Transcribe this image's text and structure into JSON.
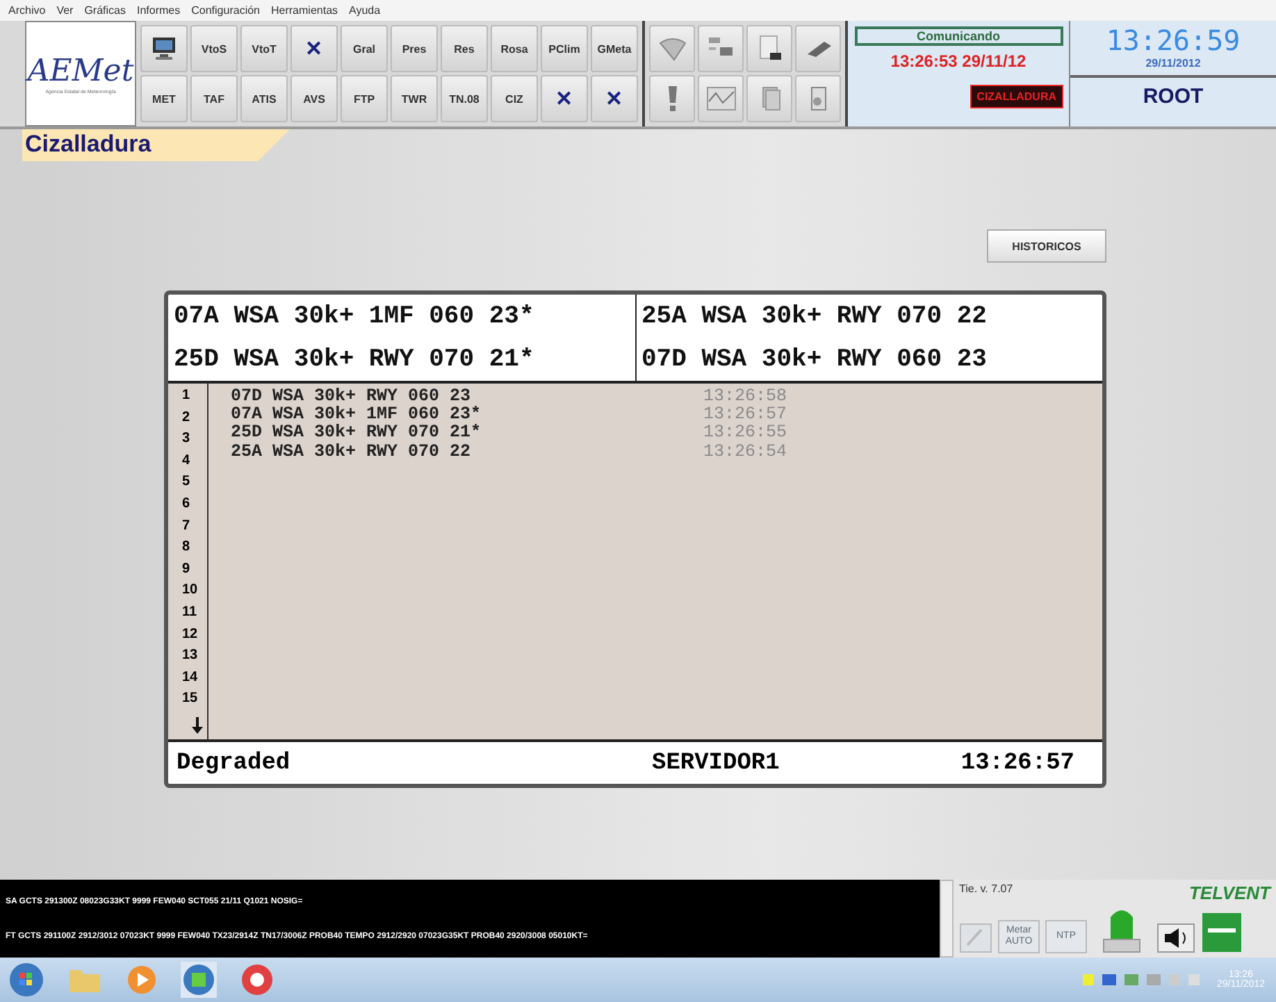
{
  "menu": [
    "Archivo",
    "Ver",
    "Gráficas",
    "Informes",
    "Configuración",
    "Herramientas",
    "Ayuda"
  ],
  "logo": {
    "name": "AEMet",
    "subtitle": "Agencia Estatal de Meteorología"
  },
  "toolbar": {
    "rows": [
      [
        {
          "kind": "monitor"
        },
        {
          "kind": "text",
          "label": "VtoS"
        },
        {
          "kind": "text",
          "label": "VtoT"
        },
        {
          "kind": "x",
          "label": "✕"
        },
        {
          "kind": "text",
          "label": "Gral"
        },
        {
          "kind": "text",
          "label": "Pres"
        },
        {
          "kind": "text",
          "label": "Res"
        },
        {
          "kind": "text",
          "label": "Rosa"
        },
        {
          "kind": "text",
          "label": "PClim"
        },
        {
          "kind": "text",
          "label": "GMeta"
        }
      ],
      [
        {
          "kind": "text",
          "label": "MET"
        },
        {
          "kind": "text",
          "label": "TAF"
        },
        {
          "kind": "text",
          "label": "ATIS"
        },
        {
          "kind": "text",
          "label": "AVS"
        },
        {
          "kind": "text",
          "label": "FTP"
        },
        {
          "kind": "text",
          "label": "TWR"
        },
        {
          "kind": "text",
          "label": "TN.08"
        },
        {
          "kind": "text",
          "label": "CIZ"
        },
        {
          "kind": "x",
          "label": "✕"
        },
        {
          "kind": "x",
          "label": "✕"
        }
      ]
    ]
  },
  "status": {
    "connection": "Comunicando",
    "timestamp": "13:26:53 29/11/12",
    "alert": "CIZALLADURA"
  },
  "clock": {
    "time": "13:26:59",
    "date": "29/11/2012",
    "user": "ROOT"
  },
  "section_title": "Cizalladura",
  "history_button": "HISTORICOS",
  "alerts": [
    [
      "07A WSA 30k+ 1MF 060 23*",
      "25A WSA 30k+ RWY 070 22"
    ],
    [
      "25D WSA 30k+ RWY 070 21*",
      "07D WSA 30k+ RWY 060 23"
    ]
  ],
  "log": [
    {
      "number": "1",
      "message": "07D WSA 30k+ RWY 060 23",
      "time": "13:26:58"
    },
    {
      "number": "2",
      "message": "07A WSA 30k+ 1MF 060 23*",
      "time": "13:26:57"
    },
    {
      "number": "3",
      "message": "25D WSA 30k+ RWY 070 21*",
      "time": "13:26:55"
    },
    {
      "number": "4",
      "message": "25A WSA 30k+ RWY 070 22",
      "time": "13:26:54"
    },
    {
      "number": "5"
    },
    {
      "number": "6"
    },
    {
      "number": "7"
    },
    {
      "number": "8"
    },
    {
      "number": "9"
    },
    {
      "number": "10"
    },
    {
      "number": "11"
    },
    {
      "number": "12"
    },
    {
      "number": "13"
    },
    {
      "number": "14"
    },
    {
      "number": "15"
    }
  ],
  "footer": {
    "state": "Degraded",
    "server": "SERVIDOR1",
    "time": "13:26:57"
  },
  "messages": [
    "SA GCTS 291300Z 08023G33KT 9999 FEW040 SCT055 21/11 Q1021 NOSIG=",
    "FT GCTS 291100Z 2912/3012 07023KT 9999 FEW040 TX23/2914Z TN17/3006Z PROB40 TEMPO 2912/2920 07023G35KT PROB40 2920/3008 05010KT="
  ],
  "version": "Tie. v. 7.07",
  "brand": "TELVENT",
  "side_buttons": [
    {
      "label": "Metar AUTO",
      "disabled": true
    },
    {
      "label": "NTP",
      "disabled": true
    }
  ],
  "taskbar": {
    "time": "13:26",
    "date": "29/11/2012"
  }
}
